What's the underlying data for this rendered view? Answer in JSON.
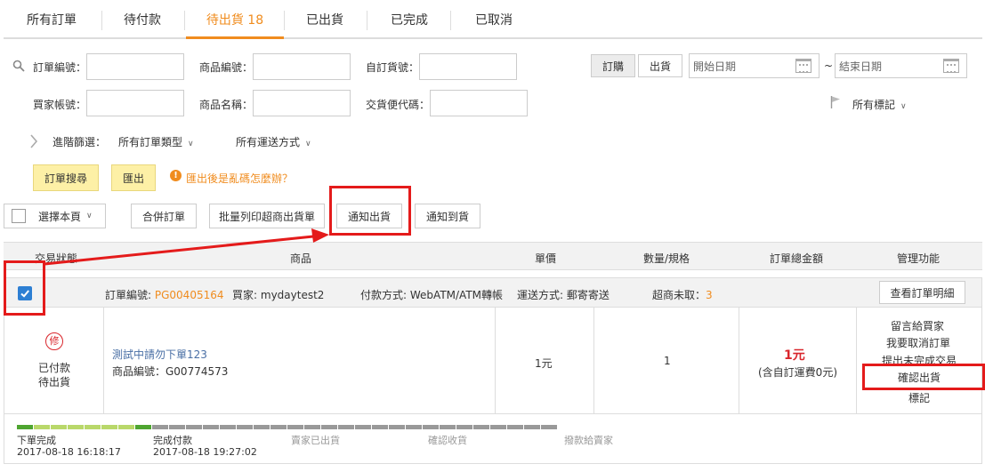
{
  "tabs": [
    {
      "label": "所有訂單"
    },
    {
      "label": "待付款"
    },
    {
      "label": "待出貨 18"
    },
    {
      "label": "已出貨"
    },
    {
      "label": "已完成"
    },
    {
      "label": "已取消"
    }
  ],
  "filters": {
    "order_no_label": "訂單編號：",
    "product_no_label": "商品編號：",
    "custom_ship_no_label": "自訂貨號：",
    "buyer_account_label": "買家帳號：",
    "product_name_label": "商品名稱：",
    "delivery_code_label": "交貨便代碼：",
    "mode_order": "訂購",
    "mode_ship": "出貨",
    "start_date_placeholder": "開始日期",
    "date_sep": "~",
    "end_date_placeholder": "結束日期",
    "all_marks": "所有標記",
    "advanced_label": "進階篩選：",
    "all_order_types": "所有訂單類型",
    "all_delivery": "所有運送方式",
    "search_btn": "訂單搜尋",
    "export_btn": "匯出",
    "export_help": "匯出後是亂碼怎麼辦？"
  },
  "actions": {
    "select_page": "選擇本頁",
    "merge": "合併訂單",
    "batch_print": "批量列印超商出貨單",
    "notify_ship": "通知出貨",
    "notify_arrival": "通知到貨"
  },
  "table": {
    "headers": [
      "交易狀態",
      "商品",
      "單價",
      "數量/規格",
      "訂單總金額",
      "管理功能"
    ]
  },
  "order": {
    "order_no_label": "訂單編號:",
    "order_no": "PG00405164",
    "buyer_label": "買家:",
    "buyer": "mydaytest2",
    "payment_label": "付款方式:",
    "payment": "WebATM/ATM轉帳",
    "delivery_label": "運送方式:",
    "delivery": "郵寄寄送",
    "cvs_label": "超商未取：",
    "cvs": "3",
    "detail_btn": "查看訂單明細",
    "stamp": "修",
    "status_line1": "已付款",
    "status_line2": "待出貨",
    "product_name": "測試中請勿下單123",
    "product_no": "商品編號：G00774573",
    "unit_price": "1元",
    "quantity": "1",
    "total": "1元",
    "total_note": "(含自訂運費0元)",
    "manage": [
      "留言給買家",
      "我要取消訂單",
      "提出未完成交易",
      "確認出貨",
      "標記"
    ]
  },
  "progress": {
    "steps": [
      {
        "label": "下單完成",
        "time": "2017-08-18 16:18:17",
        "done": true
      },
      {
        "label": "完成付款",
        "time": "2017-08-18 19:27:02",
        "done": true
      },
      {
        "label": "賣家已出貨",
        "time": "",
        "done": false
      },
      {
        "label": "確認收貨",
        "time": "",
        "done": false
      },
      {
        "label": "撥款給賣家",
        "time": "",
        "done": false
      }
    ]
  },
  "colors": {
    "accent": "#f08c1e",
    "annotation_red": "#e41b1b",
    "checkbox_blue": "#2d7fd3",
    "stamp_red": "#d9262c"
  }
}
